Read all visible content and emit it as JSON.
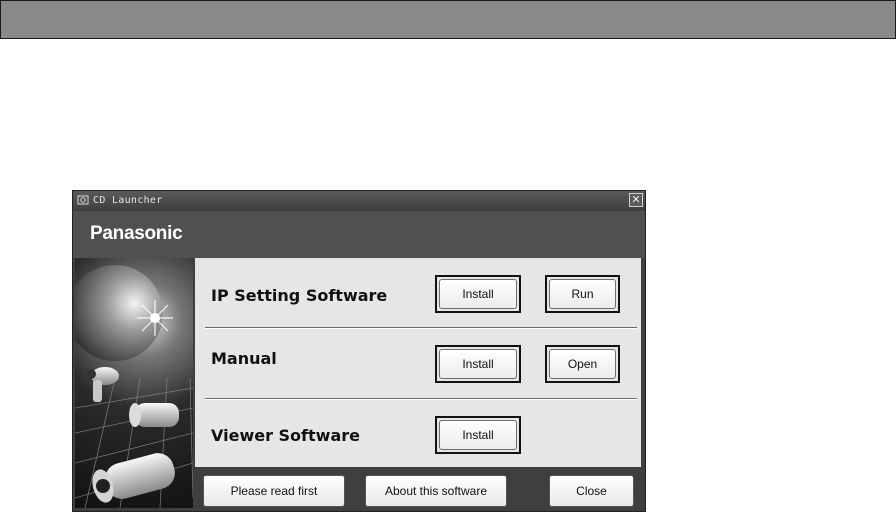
{
  "window": {
    "title": "CD Launcher",
    "brand": "Panasonic"
  },
  "sections": [
    {
      "label": "IP Setting Software",
      "buttons": [
        "Install",
        "Run"
      ]
    },
    {
      "label": "Manual",
      "buttons": [
        "Install",
        "Open"
      ]
    },
    {
      "label": "Viewer Software",
      "buttons": [
        "Install"
      ]
    }
  ],
  "footer": {
    "read_first": "Please read first",
    "about": "About this software",
    "close": "Close"
  },
  "icons": {
    "close": "close-icon",
    "app": "cd-icon"
  },
  "colors": {
    "window_bg": "#3f3f3f",
    "panel_bg": "#e6e6e6",
    "brand_bar": "#505050",
    "top_bar": "#8a8a8a"
  }
}
